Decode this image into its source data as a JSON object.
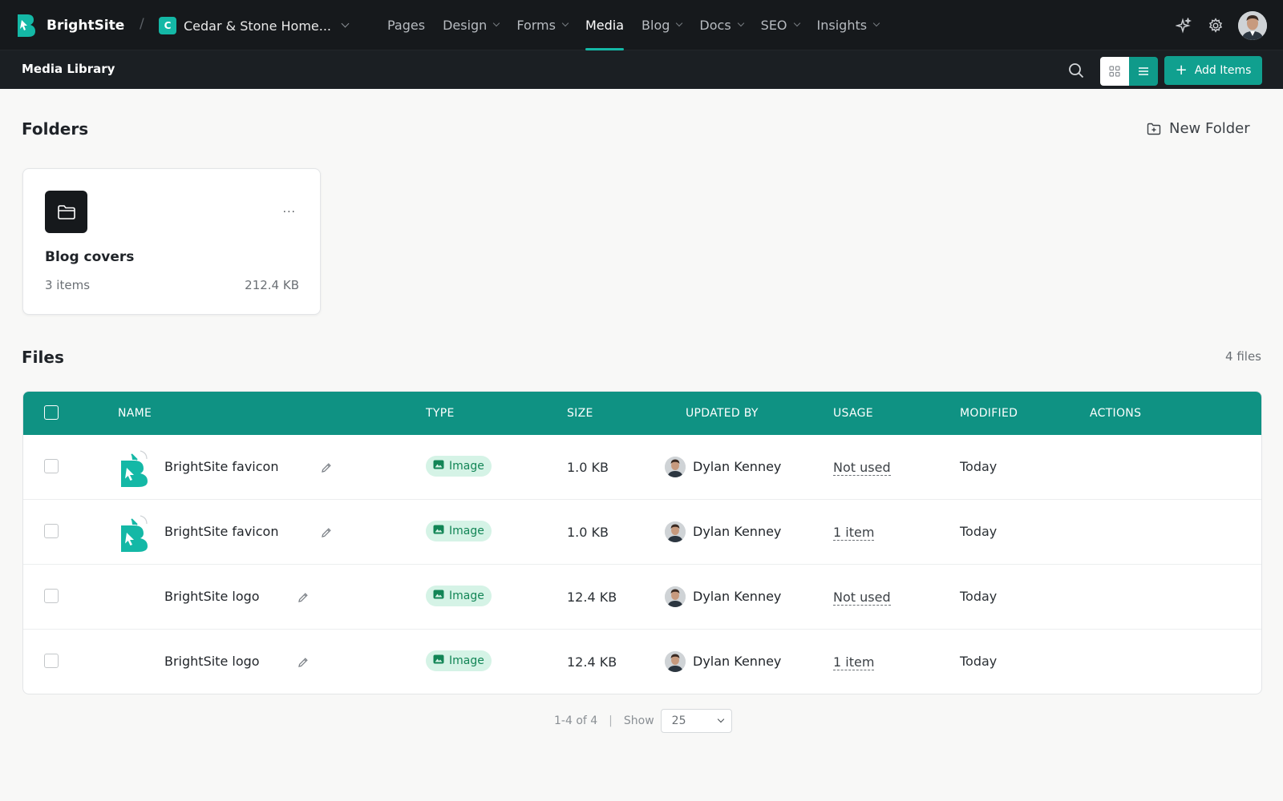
{
  "brand": {
    "name": "BrightSite"
  },
  "breadcrumb": {
    "separator": "/",
    "site_initial": "C",
    "site_name": "Cedar & Stone Home..."
  },
  "nav": [
    {
      "label": "Pages",
      "has_menu": false,
      "active": false
    },
    {
      "label": "Design",
      "has_menu": true,
      "active": false
    },
    {
      "label": "Forms",
      "has_menu": true,
      "active": false
    },
    {
      "label": "Media",
      "has_menu": false,
      "active": true
    },
    {
      "label": "Blog",
      "has_menu": true,
      "active": false
    },
    {
      "label": "Docs",
      "has_menu": true,
      "active": false
    },
    {
      "label": "SEO",
      "has_menu": true,
      "active": false
    },
    {
      "label": "Insights",
      "has_menu": true,
      "active": false
    }
  ],
  "top_icons": [
    "sparkle-icon",
    "gear-icon"
  ],
  "subheader": {
    "title": "Media Library",
    "add_label": "Add Items",
    "view_mode": "list"
  },
  "folders": {
    "title": "Folders",
    "new_folder_label": "New Folder",
    "items": [
      {
        "name": "Blog covers",
        "count": "3 items",
        "size": "212.4 KB",
        "menu": "..."
      }
    ]
  },
  "files": {
    "title": "Files",
    "count": "4 files",
    "columns": [
      "NAME",
      "TYPE",
      "SIZE",
      "UPDATED BY",
      "USAGE",
      "MODIFIED",
      "ACTIONS"
    ],
    "rows": [
      {
        "name": "BrightSite favicon",
        "thumb": "favicon",
        "type": "Image",
        "size": "1.0 KB",
        "updated_by": "Dylan Kenney",
        "usage": "Not used",
        "modified": "Today"
      },
      {
        "name": "BrightSite favicon",
        "thumb": "favicon",
        "type": "Image",
        "size": "1.0 KB",
        "updated_by": "Dylan Kenney",
        "usage": "1 item",
        "modified": "Today"
      },
      {
        "name": "BrightSite logo",
        "thumb": "none",
        "type": "Image",
        "size": "12.4 KB",
        "updated_by": "Dylan Kenney",
        "usage": "Not used",
        "modified": "Today"
      },
      {
        "name": "BrightSite logo",
        "thumb": "none",
        "type": "Image",
        "size": "12.4 KB",
        "updated_by": "Dylan Kenney",
        "usage": "1 item",
        "modified": "Today"
      }
    ]
  },
  "pagination": {
    "range": "1-4 of 4",
    "separator": "|",
    "show_label": "Show",
    "page_size": "25"
  },
  "colors": {
    "accent": "#10a08f",
    "header_bg": "#0f9283",
    "topbar_bg": "#16191c",
    "badge_bg": "#d5f3e6",
    "badge_text": "#128556"
  }
}
